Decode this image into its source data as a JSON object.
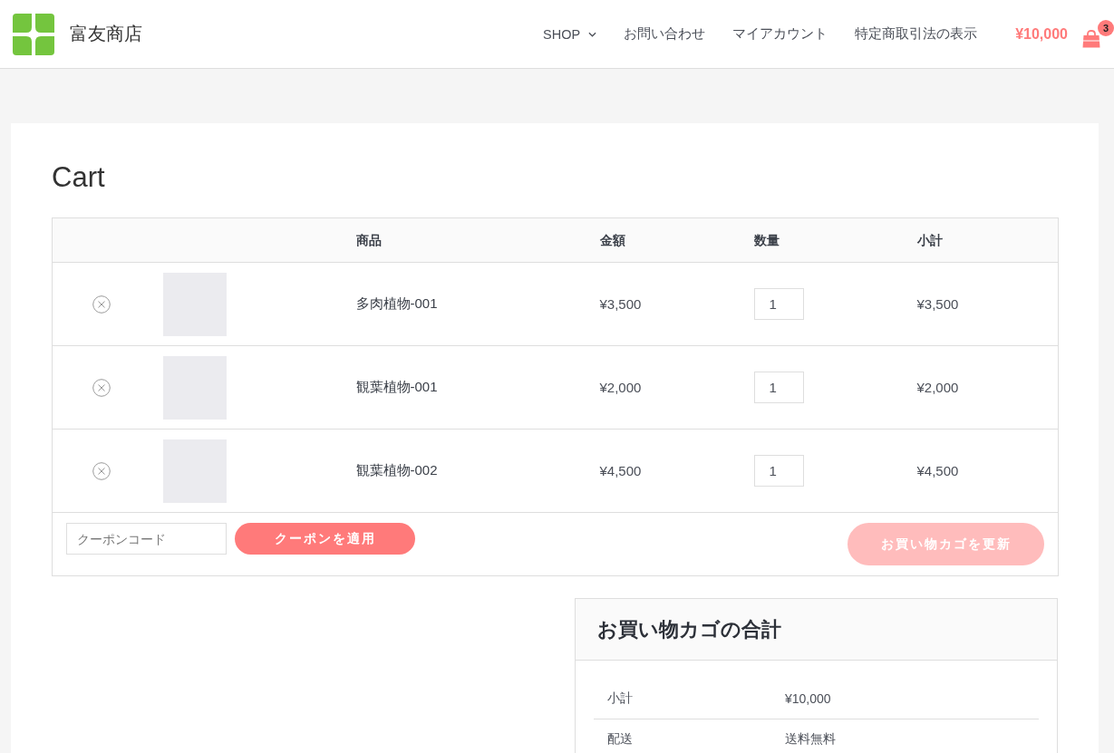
{
  "header": {
    "site_title": "富友商店",
    "nav": [
      {
        "label": "SHOP",
        "has_dropdown": true
      },
      {
        "label": "お問い合わせ",
        "has_dropdown": false
      },
      {
        "label": "マイアカウント",
        "has_dropdown": false
      },
      {
        "label": "特定商取引法の表示",
        "has_dropdown": false
      }
    ],
    "cart_total": "¥10,000",
    "cart_count": "3"
  },
  "page_title": "Cart",
  "cart_table": {
    "columns": [
      "商品",
      "金額",
      "数量",
      "小計"
    ],
    "rows": [
      {
        "product": "多肉植物-001",
        "price": "¥3,500",
        "quantity": "1",
        "subtotal": "¥3,500"
      },
      {
        "product": "観葉植物-001",
        "price": "¥2,000",
        "quantity": "1",
        "subtotal": "¥2,000"
      },
      {
        "product": "観葉植物-002",
        "price": "¥4,500",
        "quantity": "1",
        "subtotal": "¥4,500"
      }
    ]
  },
  "coupon": {
    "placeholder": "クーポンコード",
    "apply_label": "クーポンを適用"
  },
  "update_button": {
    "label": "お買い物カゴを更新",
    "disabled": true
  },
  "totals": {
    "title": "お買い物カゴの合計",
    "rows": [
      {
        "label": "小計",
        "value": "¥10,000"
      },
      {
        "label": "配送",
        "value": "送料無料"
      }
    ]
  }
}
